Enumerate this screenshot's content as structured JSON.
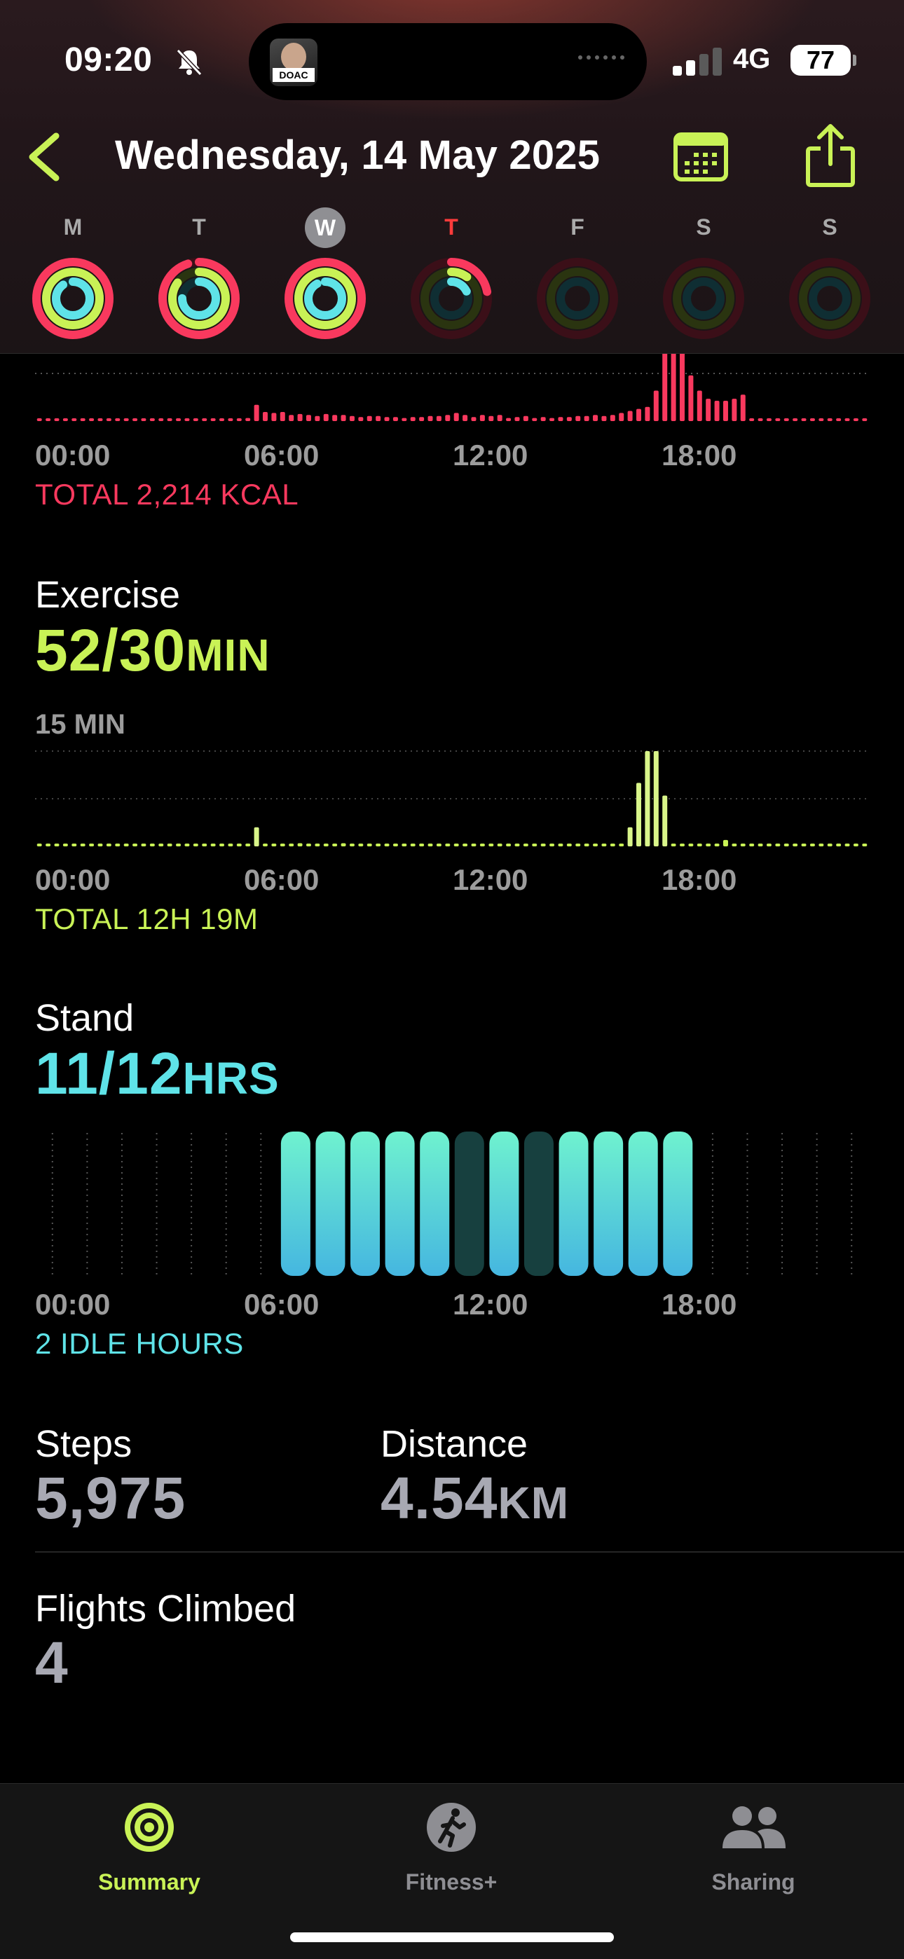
{
  "status_bar": {
    "time": "09:20",
    "network": "4G",
    "battery": "77",
    "island_tag": "DOAC"
  },
  "header": {
    "date_title": "Wednesday, 14 May 2025"
  },
  "week": {
    "days": [
      {
        "letter": "M",
        "state": "past",
        "move": 1.0,
        "exercise": 1.0,
        "stand": 0.9
      },
      {
        "letter": "T",
        "state": "past",
        "move": 0.95,
        "exercise": 0.85,
        "stand": 0.75
      },
      {
        "letter": "W",
        "state": "selected",
        "move": 1.0,
        "exercise": 1.0,
        "stand": 0.92
      },
      {
        "letter": "T",
        "state": "today",
        "move": 0.22,
        "exercise": 0.1,
        "stand": 0.18
      },
      {
        "letter": "F",
        "state": "future",
        "move": 0,
        "exercise": 0,
        "stand": 0
      },
      {
        "letter": "S",
        "state": "future",
        "move": 0,
        "exercise": 0,
        "stand": 0
      },
      {
        "letter": "S",
        "state": "future",
        "move": 0,
        "exercise": 0,
        "stand": 0
      }
    ]
  },
  "move": {
    "axis_ticks": [
      "00:00",
      "06:00",
      "12:00",
      "18:00"
    ],
    "total": "TOTAL 2,214 KCAL"
  },
  "exercise": {
    "label": "Exercise",
    "value": "52/30",
    "unit": "MIN",
    "scale": "15 MIN",
    "axis_ticks": [
      "00:00",
      "06:00",
      "12:00",
      "18:00"
    ],
    "total": "TOTAL 12H 19M"
  },
  "stand": {
    "label": "Stand",
    "value": "11/12",
    "unit": "HRS",
    "axis_ticks": [
      "00:00",
      "06:00",
      "12:00",
      "18:00"
    ],
    "idle": "2 IDLE HOURS"
  },
  "steps": {
    "label": "Steps",
    "value": "5,975"
  },
  "distance": {
    "label": "Distance",
    "value": "4.54",
    "unit": "KM"
  },
  "flights": {
    "label": "Flights Climbed",
    "value": "4"
  },
  "tabs": {
    "summary": "Summary",
    "fitness": "Fitness+",
    "sharing": "Sharing"
  },
  "colors": {
    "move": "#f9395e",
    "exercise": "#c9f256",
    "stand": "#5fe3e8",
    "tab_active": "#c9f256",
    "tab_inactive": "#8e8e93"
  },
  "chart_data": [
    {
      "type": "bar",
      "title": "",
      "x_range": [
        "00:00",
        "24:00"
      ],
      "bin_minutes": 15,
      "series": [
        {
          "values": [
            0,
            0,
            0,
            0,
            0,
            0,
            0,
            0,
            0,
            0,
            0,
            0,
            0,
            0,
            0,
            0,
            0,
            0,
            0,
            0,
            0,
            0,
            0,
            0,
            0,
            0,
            0,
            0,
            0,
            0,
            0,
            0,
            0,
            0,
            0,
            0,
            0,
            0,
            0,
            0,
            0,
            0,
            0,
            0,
            0,
            0,
            0,
            0,
            0,
            0,
            0,
            0,
            0,
            0,
            0,
            0,
            0,
            0,
            0,
            0,
            0,
            0,
            0,
            0,
            0,
            0,
            0,
            0,
            0,
            0,
            0,
            0,
            0,
            0,
            0,
            0,
            0,
            0,
            0,
            0,
            0,
            0,
            0,
            0,
            0,
            0,
            0,
            0,
            0,
            0,
            0,
            0,
            0,
            0,
            0,
            0
          ]
        }
      ],
      "move_kcal_15min": [
        2,
        2,
        2,
        2,
        2,
        2,
        2,
        2,
        2,
        2,
        2,
        2,
        2,
        2,
        2,
        2,
        2,
        2,
        2,
        2,
        2,
        2,
        2,
        2,
        3,
        16,
        9,
        8,
        9,
        6,
        7,
        6,
        5,
        7,
        6,
        6,
        5,
        4,
        5,
        5,
        4,
        4,
        3,
        4,
        4,
        5,
        5,
        6,
        8,
        6,
        4,
        6,
        5,
        6,
        3,
        4,
        5,
        3,
        4,
        3,
        4,
        4,
        5,
        5,
        6,
        5,
        6,
        8,
        10,
        12,
        14,
        30,
        75,
        75,
        70,
        45,
        30,
        22,
        20,
        20,
        22,
        26,
        2,
        2,
        2,
        2,
        2,
        2,
        2,
        2,
        2,
        2,
        2,
        2,
        2,
        2
      ]
    },
    {
      "type": "bar",
      "title": "",
      "ylabel": "15 MIN",
      "ylim": [
        0,
        15
      ],
      "x_range": [
        "00:00",
        "24:00"
      ],
      "exercise_min_15min": [
        0,
        0,
        0,
        0,
        0,
        0,
        0,
        0,
        0,
        0,
        0,
        0,
        0,
        0,
        0,
        0,
        0,
        0,
        0,
        0,
        0,
        0,
        0,
        0,
        0,
        3,
        0,
        0,
        0,
        0,
        0.5,
        0,
        0,
        0,
        0,
        0.5,
        0,
        0,
        0,
        0,
        0,
        0,
        0,
        0,
        0,
        0,
        0,
        0,
        0,
        0,
        0,
        0,
        0,
        0,
        0,
        0,
        0,
        0,
        0,
        0,
        0,
        0,
        0,
        0,
        0,
        0,
        0,
        0,
        3,
        10,
        15,
        15,
        8,
        0,
        0,
        0,
        0,
        0,
        0,
        1,
        0,
        0,
        0,
        0,
        0,
        0,
        0,
        0,
        0,
        0,
        0,
        0,
        0,
        0,
        0,
        0
      ]
    },
    {
      "type": "bar",
      "title": "",
      "x_range": [
        "00:00",
        "24:00"
      ],
      "stand_hours": [
        0,
        0,
        0,
        0,
        0,
        0,
        0,
        1,
        1,
        1,
        1,
        1,
        0,
        1,
        0,
        1,
        1,
        1,
        1,
        1,
        0,
        0,
        0,
        0
      ],
      "active_window": [
        7,
        19
      ]
    }
  ]
}
